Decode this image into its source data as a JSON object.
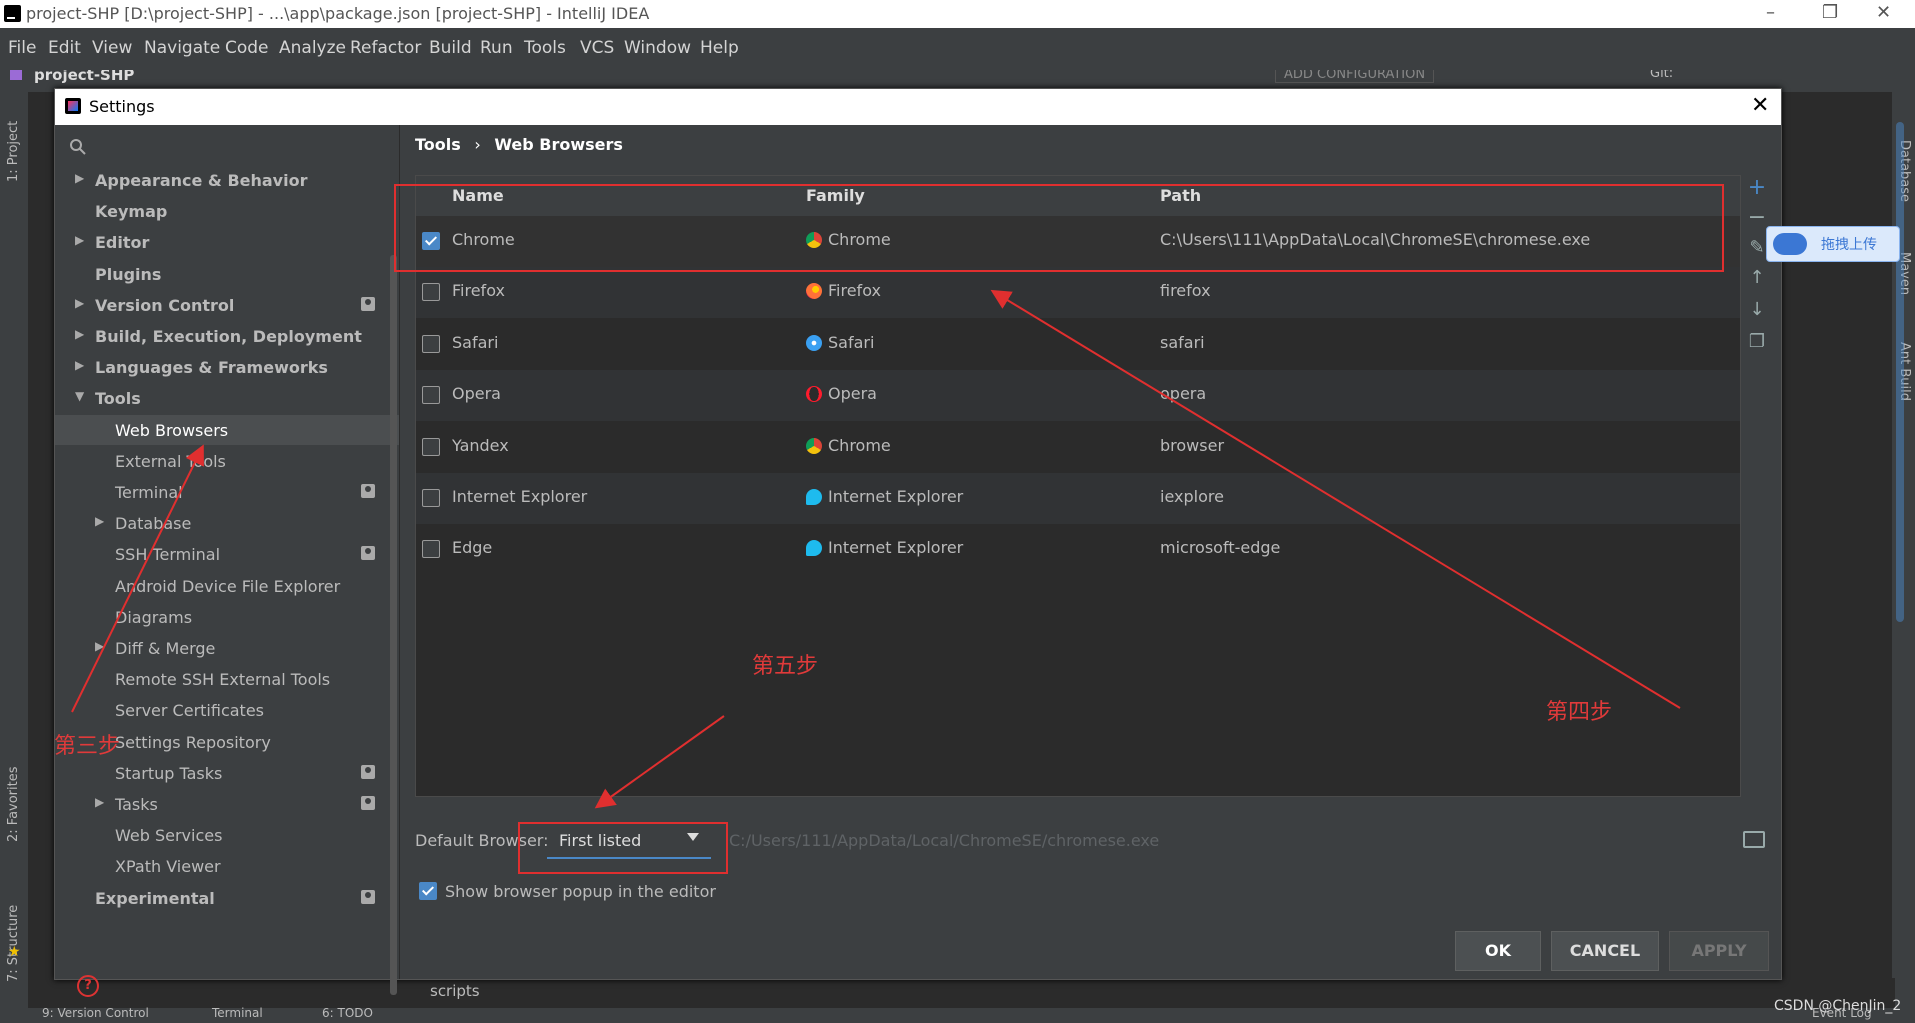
{
  "window": {
    "title": "project-SHP [D:\\project-SHP] - ...\\app\\package.json [project-SHP] - IntelliJ IDEA"
  },
  "menu": [
    "File",
    "Edit",
    "View",
    "Navigate",
    "Code",
    "Analyze",
    "Refactor",
    "Build",
    "Run",
    "Tools",
    "VCS",
    "Window",
    "Help"
  ],
  "navbar": {
    "project": "project-SHP",
    "config": "ADD CONFIGURATION",
    "git": "Git:"
  },
  "side_tabs": {
    "left": [
      "1: Project",
      "2: Favorites",
      "7: Structure"
    ],
    "right": [
      "Database",
      "Maven",
      "Ant Build"
    ]
  },
  "bottom_tabs": [
    "9: Version Control",
    "Terminal",
    "6: TODO",
    "Event Log"
  ],
  "status_text": "scripts",
  "dialog": {
    "title": "Settings",
    "search_placeholder": "",
    "breadcrumb": {
      "parent": "Tools",
      "sep": "›",
      "current": "Web Browsers"
    },
    "tree": [
      {
        "label": "Appearance & Behavior",
        "level": 0,
        "bold": true,
        "arrow": "right"
      },
      {
        "label": "Keymap",
        "level": 0,
        "bold": true
      },
      {
        "label": "Editor",
        "level": 0,
        "bold": true,
        "arrow": "right"
      },
      {
        "label": "Plugins",
        "level": 0,
        "bold": true
      },
      {
        "label": "Version Control",
        "level": 0,
        "bold": true,
        "arrow": "right",
        "settings_icon": true
      },
      {
        "label": "Build, Execution, Deployment",
        "level": 0,
        "bold": true,
        "arrow": "right"
      },
      {
        "label": "Languages & Frameworks",
        "level": 0,
        "bold": true,
        "arrow": "right"
      },
      {
        "label": "Tools",
        "level": 0,
        "bold": true,
        "arrow": "down"
      },
      {
        "label": "Web Browsers",
        "level": 1,
        "selected": true
      },
      {
        "label": "External Tools",
        "level": 1
      },
      {
        "label": "Terminal",
        "level": 1,
        "settings_icon": true
      },
      {
        "label": "Database",
        "level": 1,
        "arrow": "right"
      },
      {
        "label": "SSH Terminal",
        "level": 1,
        "settings_icon": true
      },
      {
        "label": "Android Device File Explorer",
        "level": 1
      },
      {
        "label": "Diagrams",
        "level": 1
      },
      {
        "label": "Diff & Merge",
        "level": 1,
        "arrow": "right"
      },
      {
        "label": "Remote SSH External Tools",
        "level": 1
      },
      {
        "label": "Server Certificates",
        "level": 1
      },
      {
        "label": "Settings Repository",
        "level": 1
      },
      {
        "label": "Startup Tasks",
        "level": 1,
        "settings_icon": true
      },
      {
        "label": "Tasks",
        "level": 1,
        "arrow": "right",
        "settings_icon": true
      },
      {
        "label": "Web Services",
        "level": 1
      },
      {
        "label": "XPath Viewer",
        "level": 1
      },
      {
        "label": "Experimental",
        "level": 0,
        "bold": true,
        "settings_icon": true
      }
    ],
    "table": {
      "columns": [
        "Name",
        "Family",
        "Path"
      ],
      "rows": [
        {
          "checked": true,
          "name": "Chrome",
          "family": "Chrome",
          "family_icon": "chrome-icon",
          "path": "C:\\Users\\111\\AppData\\Local\\ChromeSE\\chromese.exe"
        },
        {
          "checked": false,
          "name": "Firefox",
          "family": "Firefox",
          "family_icon": "firefox-icon",
          "path": "firefox"
        },
        {
          "checked": false,
          "name": "Safari",
          "family": "Safari",
          "family_icon": "safari-icon",
          "path": "safari"
        },
        {
          "checked": false,
          "name": "Opera",
          "family": "Opera",
          "family_icon": "opera-icon",
          "path": "opera"
        },
        {
          "checked": false,
          "name": "Yandex",
          "family": "Chrome",
          "family_icon": "chrome-icon",
          "path": "browser"
        },
        {
          "checked": false,
          "name": "Internet Explorer",
          "family": "Internet Explorer",
          "family_icon": "ie-icon",
          "path": "iexplore"
        },
        {
          "checked": false,
          "name": "Edge",
          "family": "Internet Explorer",
          "family_icon": "ie-icon",
          "path": "microsoft-edge"
        }
      ]
    },
    "toolbar_icons": [
      "add-icon",
      "remove-icon",
      "edit-icon",
      "move-up-icon",
      "move-down-icon",
      "copy-icon"
    ],
    "default_browser": {
      "label": "Default Browser:",
      "value": "First listed",
      "path": "C:/Users/111/AppData/Local/ChromeSE/chromese.exe"
    },
    "show_popup": {
      "checked": true,
      "label": "Show browser popup in the editor"
    },
    "buttons": {
      "ok": "OK",
      "cancel": "CANCEL",
      "apply": "APPLY"
    }
  },
  "annotations": {
    "step3": "第三步",
    "step4": "第四步",
    "step5": "第五步"
  },
  "upload_widget": "拖拽上传",
  "watermark": "CSDN @ChenJin_2",
  "colors": {
    "accent": "#4a88c7",
    "annotation": "#e02f2f",
    "bg": "#3c3f41"
  }
}
